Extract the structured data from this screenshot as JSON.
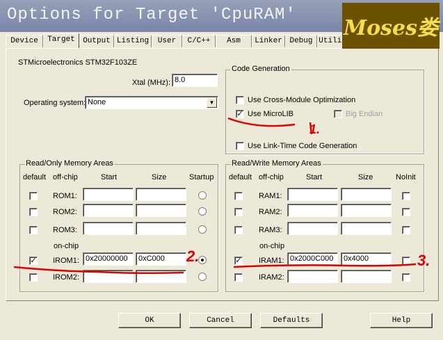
{
  "window": {
    "title": "Options for Target 'CpuRAM'"
  },
  "watermark": {
    "text": "Moses娄"
  },
  "tabs": [
    "Device",
    "Target",
    "Output",
    "Listing",
    "User",
    "C/C++",
    "Asm",
    "Linker",
    "Debug",
    "Utilities"
  ],
  "active_tab": "Target",
  "device_name": "STMicroelectronics STM32F103ZE",
  "xtal": {
    "label": "Xtal (MHz):",
    "value": "8.0"
  },
  "os": {
    "label": "Operating system:",
    "value": "None"
  },
  "code_gen": {
    "title": "Code Generation",
    "cross_module": {
      "label": "Use Cross-Module Optimization",
      "checked": false
    },
    "microlib": {
      "label": "Use MicroLIB",
      "checked": true
    },
    "big_endian": {
      "label": "Big Endian",
      "checked": false,
      "disabled": true
    },
    "ltcg": {
      "label": "Use Link-Time Code Generation",
      "checked": false
    }
  },
  "ro_memory": {
    "title": "Read/Only Memory Areas",
    "headers": {
      "default": "default",
      "offchip": "off-chip",
      "start": "Start",
      "size": "Size",
      "startup": "Startup"
    },
    "onchip_label": "on-chip",
    "rows": [
      {
        "name": "ROM1:",
        "start": "",
        "size": "",
        "default": false,
        "startup": false
      },
      {
        "name": "ROM2:",
        "start": "",
        "size": "",
        "default": false,
        "startup": false
      },
      {
        "name": "ROM3:",
        "start": "",
        "size": "",
        "default": false,
        "startup": false
      },
      {
        "name": "IROM1:",
        "start": "0x20000000",
        "size": "0xC000",
        "default": true,
        "startup": true
      },
      {
        "name": "IROM2:",
        "start": "",
        "size": "",
        "default": false,
        "startup": false
      }
    ]
  },
  "rw_memory": {
    "title": "Read/Write Memory Areas",
    "headers": {
      "default": "default",
      "offchip": "off-chip",
      "start": "Start",
      "size": "Size",
      "noinit": "NoInit"
    },
    "onchip_label": "on-chip",
    "rows": [
      {
        "name": "RAM1:",
        "start": "",
        "size": "",
        "default": false,
        "noinit": false
      },
      {
        "name": "RAM2:",
        "start": "",
        "size": "",
        "default": false,
        "noinit": false
      },
      {
        "name": "RAM3:",
        "start": "",
        "size": "",
        "default": false,
        "noinit": false
      },
      {
        "name": "IRAM1:",
        "start": "0x2000C000",
        "size": "0x4000",
        "default": true,
        "noinit": false
      },
      {
        "name": "IRAM2:",
        "start": "",
        "size": "",
        "default": false,
        "noinit": false
      }
    ]
  },
  "buttons": {
    "ok": "OK",
    "cancel": "Cancel",
    "defaults": "Defaults",
    "help": "Help"
  },
  "annotations": {
    "one": "1.",
    "two": "2.",
    "three": "3."
  }
}
